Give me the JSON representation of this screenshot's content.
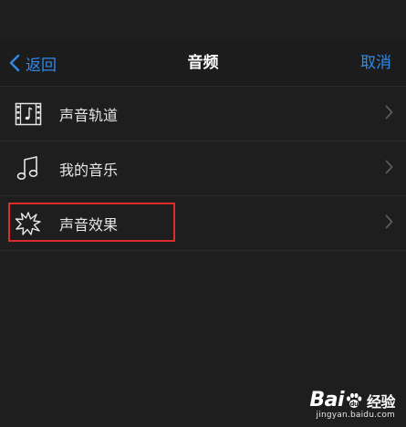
{
  "nav": {
    "back_label": "返回",
    "title": "音频",
    "cancel_label": "取消"
  },
  "items": [
    {
      "label": "声音轨道",
      "icon": "film-music-icon"
    },
    {
      "label": "我的音乐",
      "icon": "music-note-icon"
    },
    {
      "label": "声音效果",
      "icon": "sound-effect-burst-icon"
    }
  ],
  "highlight": {
    "target": "声音效果",
    "color": "#e02b2b"
  },
  "watermark": {
    "brand_left": "Bai",
    "brand_right": "经验",
    "url": "jingyan.baidu.com"
  },
  "colors": {
    "accent": "#2f8ae8",
    "background": "#1e1e1f",
    "highlight": "#e02b2b"
  }
}
